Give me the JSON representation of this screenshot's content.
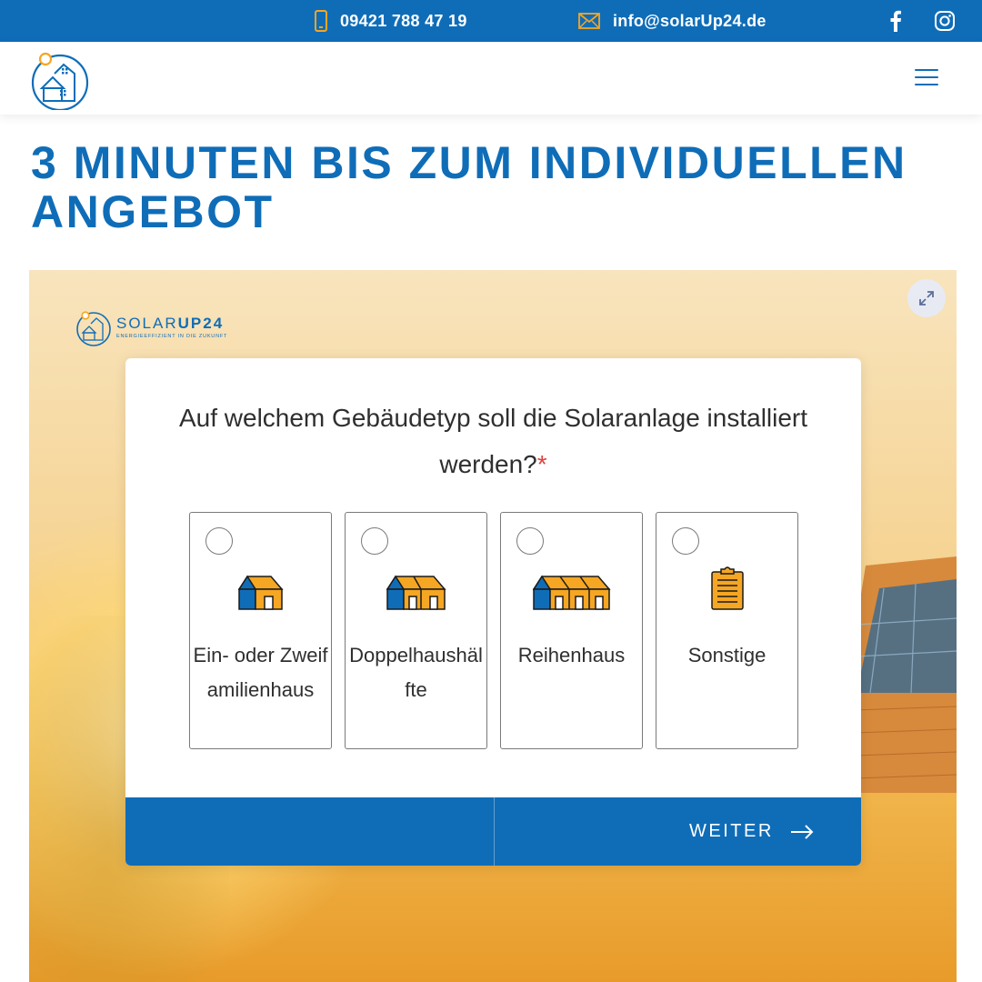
{
  "topbar": {
    "phone": "09421 788 47 19",
    "email": "info@solarUp24.de",
    "icons": [
      "phone-icon",
      "mail-icon",
      "facebook-icon",
      "instagram-icon"
    ]
  },
  "header": {
    "logo": "solarup24-house-logo",
    "menu_icon": "hamburger-menu-icon"
  },
  "page": {
    "title": "3 Minuten bis zum individuellen Angebot"
  },
  "form": {
    "brand_name_part1": "SOLAR",
    "brand_name_part2": "UP24",
    "brand_tagline": "ENERGIEEFFIZIENT IN DIE ZUKUNFT",
    "question": "Auf welchem Gebäudetyp soll die Solaranlage installiert werden?",
    "required_mark": "*",
    "options": [
      {
        "label": "Ein- oder Zweifamilienhaus",
        "icon": "single-house-icon"
      },
      {
        "label": "Doppelhaushälfte",
        "icon": "semi-detached-house-icon"
      },
      {
        "label": "Reihenhaus",
        "icon": "terraced-house-icon"
      },
      {
        "label": "Sonstige",
        "icon": "clipboard-icon"
      }
    ],
    "next_label": "WEITER"
  },
  "colors": {
    "brand_blue": "#0f6db8",
    "accent_orange": "#f5a623",
    "required_red": "#e2403c"
  }
}
